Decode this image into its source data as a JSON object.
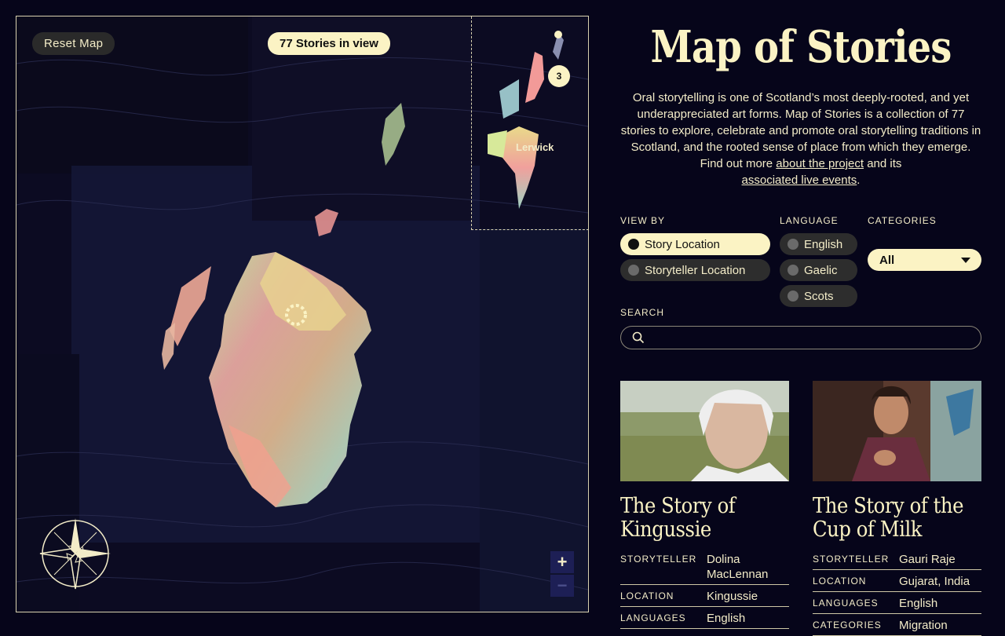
{
  "map": {
    "reset_label": "Reset Map",
    "count_label": "77 Stories in view",
    "inset_place": "Lerwick",
    "cluster_count": "3",
    "zoom_in": "+",
    "zoom_out": "−"
  },
  "panel": {
    "title": "Map of Stories",
    "intro_text": "Oral storytelling is one of Scotland’s most deeply-rooted, and yet underappreciated art forms. Map of Stories is a collection of 77 stories to explore, celebrate and promote oral storytelling traditions in Scotland, and the rooted sense of place from which they emerge. Find out more ",
    "intro_link1": "about the project",
    "intro_mid": " and its ",
    "intro_link2": "associated live events",
    "intro_end": "."
  },
  "filters": {
    "view_by_label": "VIEW BY",
    "view_by": [
      {
        "label": "Story Location",
        "selected": true
      },
      {
        "label": "Storyteller Location",
        "selected": false
      }
    ],
    "language_label": "LANGUAGE",
    "languages": [
      {
        "label": "English"
      },
      {
        "label": "Gaelic"
      },
      {
        "label": "Scots"
      }
    ],
    "categories_label": "CATEGORIES",
    "categories_value": "All",
    "search_label": "SEARCH",
    "search_value": ""
  },
  "cards": [
    {
      "title": "The Story of Kingussie",
      "rows": [
        {
          "k": "STORYTELLER",
          "v": "Dolina MacLennan"
        },
        {
          "k": "LOCATION",
          "v": "Kingussie"
        },
        {
          "k": "LANGUAGES",
          "v": "English"
        }
      ]
    },
    {
      "title": "The Story of the Cup of Milk",
      "rows": [
        {
          "k": "STORYTELLER",
          "v": "Gauri Raje"
        },
        {
          "k": "LOCATION",
          "v": "Gujarat, India"
        },
        {
          "k": "LANGUAGES",
          "v": "English"
        },
        {
          "k": "CATEGORIES",
          "v": "Migration"
        }
      ]
    }
  ]
}
